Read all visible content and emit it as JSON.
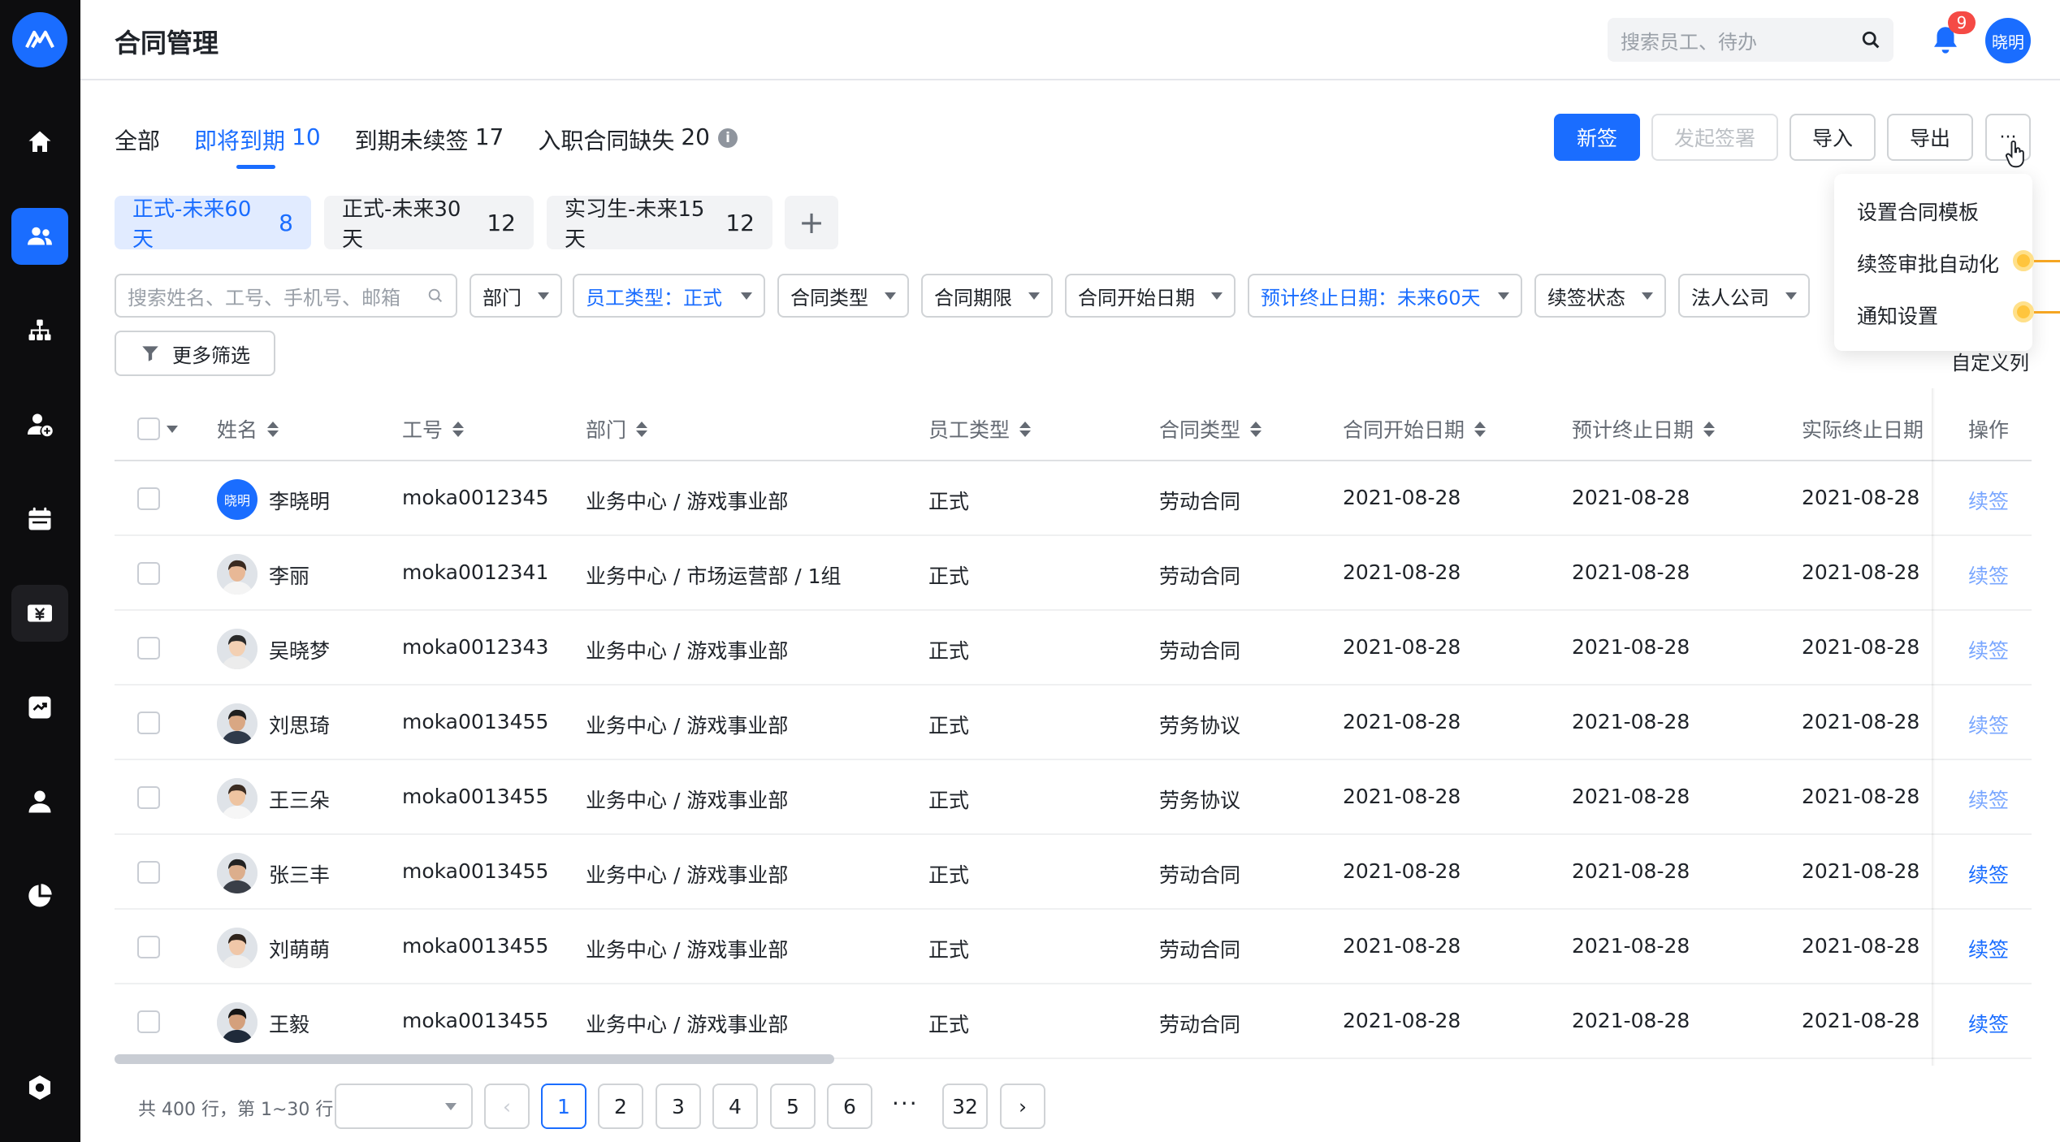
{
  "header": {
    "title": "合同管理",
    "search_placeholder": "搜索员工、待办",
    "notification_count": "9",
    "user_avatar": "晓明"
  },
  "sidebar": {
    "items": [
      "home-icon",
      "users-icon",
      "org-icon",
      "user-add-icon",
      "calendar-icon",
      "payroll-icon",
      "report-icon",
      "profile-icon",
      "analytics-icon",
      "settings-icon"
    ],
    "active_index": 1
  },
  "tabs": [
    {
      "label": "全部",
      "count": ""
    },
    {
      "label": "即将到期",
      "count": "10"
    },
    {
      "label": "到期未续签",
      "count": "17"
    },
    {
      "label": "入职合同缺失",
      "count": "20"
    }
  ],
  "toolbar": {
    "new": "新签",
    "initiate": "发起签署",
    "import": "导入",
    "export": "导出",
    "more": "···"
  },
  "more_menu": [
    "设置合同模板",
    "续签审批自动化",
    "通知设置"
  ],
  "quick_filters": [
    {
      "label": "正式-未来60天",
      "count": "8"
    },
    {
      "label": "正式-未来30天",
      "count": "12"
    },
    {
      "label": "实习生-未来15天",
      "count": "12"
    }
  ],
  "filters": {
    "search_placeholder": "搜索姓名、工号、手机号、邮箱",
    "department": "部门",
    "employee_type": "员工类型：正式",
    "contract_type": "合同类型",
    "contract_period": "合同期限",
    "start_date": "合同开始日期",
    "end_date": "预计终止日期：未来60天",
    "renew_status": "续签状态",
    "legal_entity": "法人公司",
    "more": "更多筛选",
    "custom_columns": "自定义列"
  },
  "table": {
    "columns": [
      "姓名",
      "工号",
      "部门",
      "员工类型",
      "合同类型",
      "合同开始日期",
      "预计终止日期",
      "实际终止日期",
      "操作"
    ],
    "rows": [
      {
        "name": "李晓明",
        "avatar": "晓明",
        "id": "moka0012345",
        "dept": "业务中心 / 游戏事业部",
        "type": "正式",
        "contract": "劳动合同",
        "start": "2021-08-28",
        "end": "2021-08-28",
        "actual": "2021-08-28",
        "op": "续签"
      },
      {
        "name": "李丽",
        "avatar": "",
        "id": "moka0012341",
        "dept": "业务中心 / 市场运营部 / 1组",
        "type": "正式",
        "contract": "劳动合同",
        "start": "2021-08-28",
        "end": "2021-08-28",
        "actual": "2021-08-28",
        "op": "续签"
      },
      {
        "name": "吴晓梦",
        "avatar": "",
        "id": "moka0012343",
        "dept": "业务中心 / 游戏事业部",
        "type": "正式",
        "contract": "劳动合同",
        "start": "2021-08-28",
        "end": "2021-08-28",
        "actual": "2021-08-28",
        "op": "续签"
      },
      {
        "name": "刘思琦",
        "avatar": "",
        "id": "moka0013455",
        "dept": "业务中心 / 游戏事业部",
        "type": "正式",
        "contract": "劳务协议",
        "start": "2021-08-28",
        "end": "2021-08-28",
        "actual": "2021-08-28",
        "op": "续签"
      },
      {
        "name": "王三朵",
        "avatar": "",
        "id": "moka0013455",
        "dept": "业务中心 / 游戏事业部",
        "type": "正式",
        "contract": "劳务协议",
        "start": "2021-08-28",
        "end": "2021-08-28",
        "actual": "2021-08-28",
        "op": "续签"
      },
      {
        "name": "张三丰",
        "avatar": "",
        "id": "moka0013455",
        "dept": "业务中心 / 游戏事业部",
        "type": "正式",
        "contract": "劳动合同",
        "start": "2021-08-28",
        "end": "2021-08-28",
        "actual": "2021-08-28",
        "op": "续签"
      },
      {
        "name": "刘萌萌",
        "avatar": "",
        "id": "moka0013455",
        "dept": "业务中心 / 游戏事业部",
        "type": "正式",
        "contract": "劳动合同",
        "start": "2021-08-28",
        "end": "2021-08-28",
        "actual": "2021-08-28",
        "op": "续签"
      },
      {
        "name": "王毅",
        "avatar": "",
        "id": "moka0013455",
        "dept": "业务中心 / 游戏事业部",
        "type": "正式",
        "contract": "劳动合同",
        "start": "2021-08-28",
        "end": "2021-08-28",
        "actual": "2021-08-28",
        "op": "续签"
      }
    ]
  },
  "pagination": {
    "total": "共 400 行，第 1~30 行",
    "pages": [
      "1",
      "2",
      "3",
      "4",
      "5",
      "6"
    ],
    "last": "32",
    "dots": "···",
    "prev": "‹",
    "next": "›"
  },
  "colors": {
    "accent": "#1a6dff",
    "sidebar": "#0d0d0f",
    "badge": "#f54a45"
  }
}
